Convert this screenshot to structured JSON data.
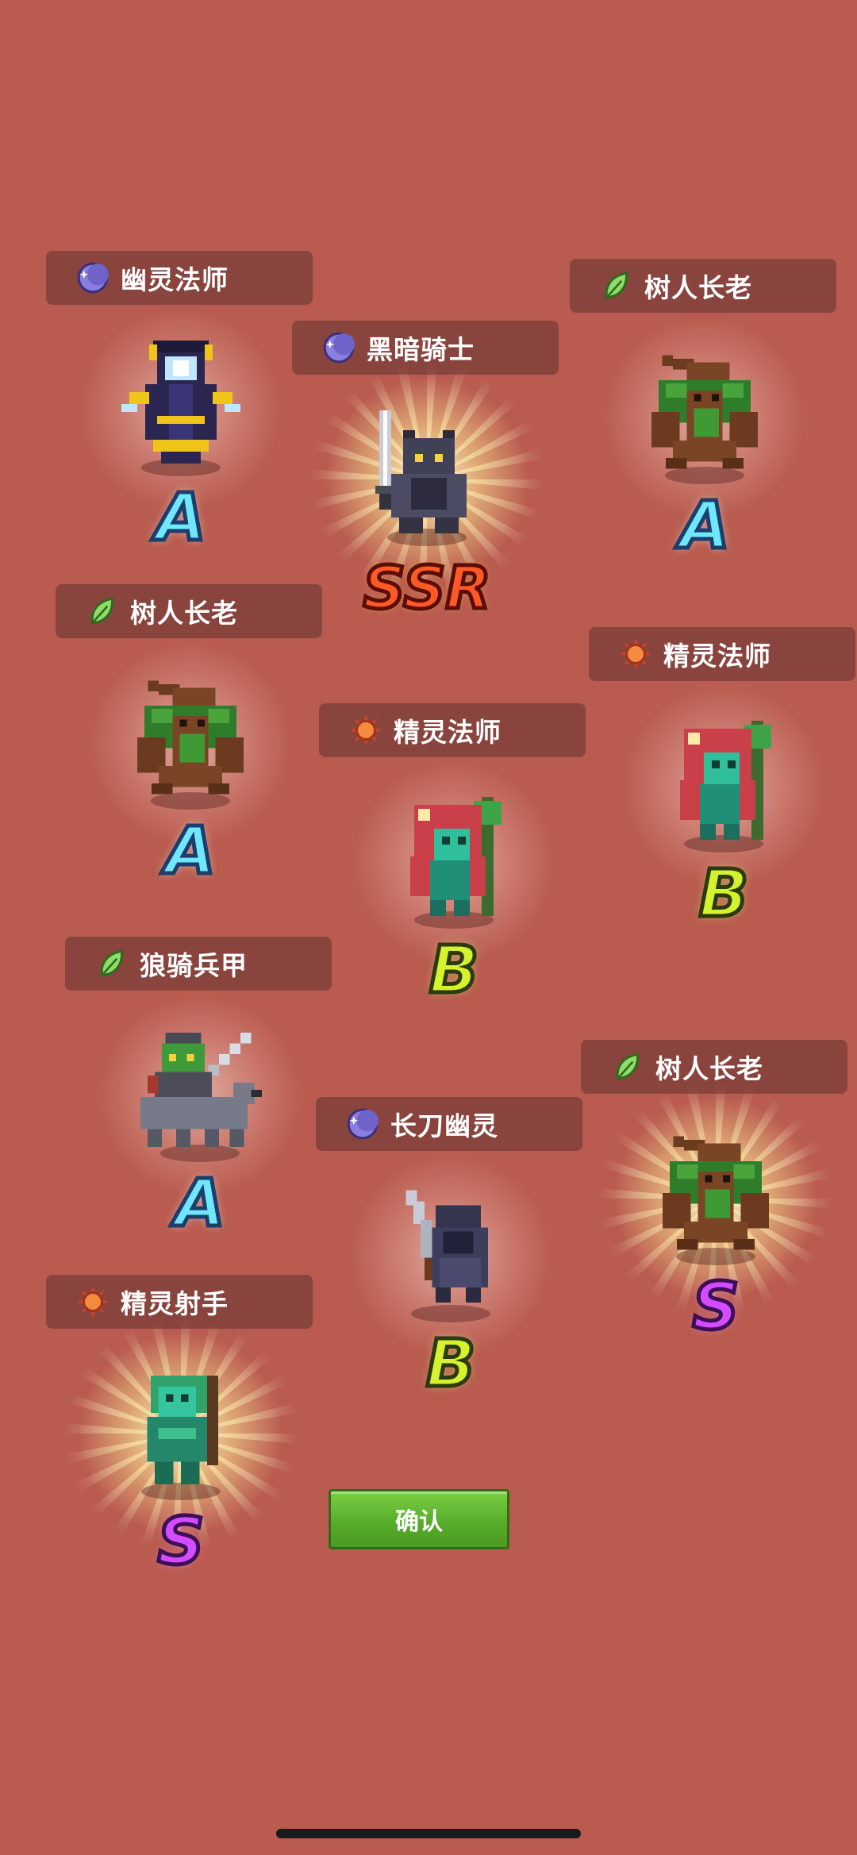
{
  "cards": [
    {
      "name": "幽灵法师",
      "element": "moon",
      "unit": "ghost-mage",
      "grade": "A"
    },
    {
      "name": "黑暗骑士",
      "element": "moon",
      "unit": "dark-knight",
      "grade": "SSR"
    },
    {
      "name": "树人长老",
      "element": "leaf",
      "unit": "treant-elder",
      "grade": "A"
    },
    {
      "name": "树人长老",
      "element": "leaf",
      "unit": "treant-elder",
      "grade": "A"
    },
    {
      "name": "精灵法师",
      "element": "sun",
      "unit": "elf-mage",
      "grade": "B"
    },
    {
      "name": "精灵法师",
      "element": "sun",
      "unit": "elf-mage",
      "grade": "B"
    },
    {
      "name": "狼骑兵甲",
      "element": "leaf",
      "unit": "wolf-rider",
      "grade": "A"
    },
    {
      "name": "长刀幽灵",
      "element": "moon",
      "unit": "blade-ghost",
      "grade": "B"
    },
    {
      "name": "树人长老",
      "element": "leaf",
      "unit": "treant-elder",
      "grade": "S"
    },
    {
      "name": "精灵射手",
      "element": "sun",
      "unit": "elf-archer",
      "grade": "S"
    }
  ],
  "colors": {
    "background": "#b95b4f",
    "grade_a": "#6fe8ff",
    "grade_b": "#d4f22d",
    "grade_s": "#d44cff",
    "grade_ssr": "#ff5a26",
    "confirm": "#58ad2b"
  },
  "confirm_label": "确认"
}
